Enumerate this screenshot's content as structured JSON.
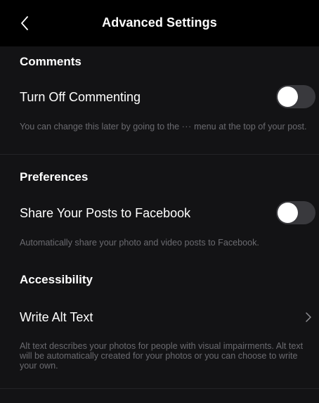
{
  "header": {
    "title": "Advanced Settings",
    "back_icon": "chevron-left-icon"
  },
  "comments": {
    "section_title": "Comments",
    "turn_off_label": "Turn Off Commenting",
    "turn_off_enabled": false,
    "caption_before": "You can change this later by going to the ",
    "caption_dots": "···",
    "caption_after": " menu at the top of your post."
  },
  "preferences": {
    "section_title": "Preferences",
    "share_label": "Share Your Posts to Facebook",
    "share_enabled": false,
    "caption": "Automatically share your photo and video posts to Facebook."
  },
  "accessibility": {
    "section_title": "Accessibility",
    "alt_text_label": "Write Alt Text",
    "chevron_icon": "chevron-right-icon",
    "caption": "Alt text describes your photos for people with visual impairments. Alt text will be automatically created for your photos or you can choose to write your own."
  },
  "colors": {
    "background": "#131315",
    "header_background": "#000000",
    "text_primary": "#ffffff",
    "text_secondary": "#6b6b70",
    "toggle_off_track": "#39393d",
    "toggle_knob": "#ffffff"
  }
}
